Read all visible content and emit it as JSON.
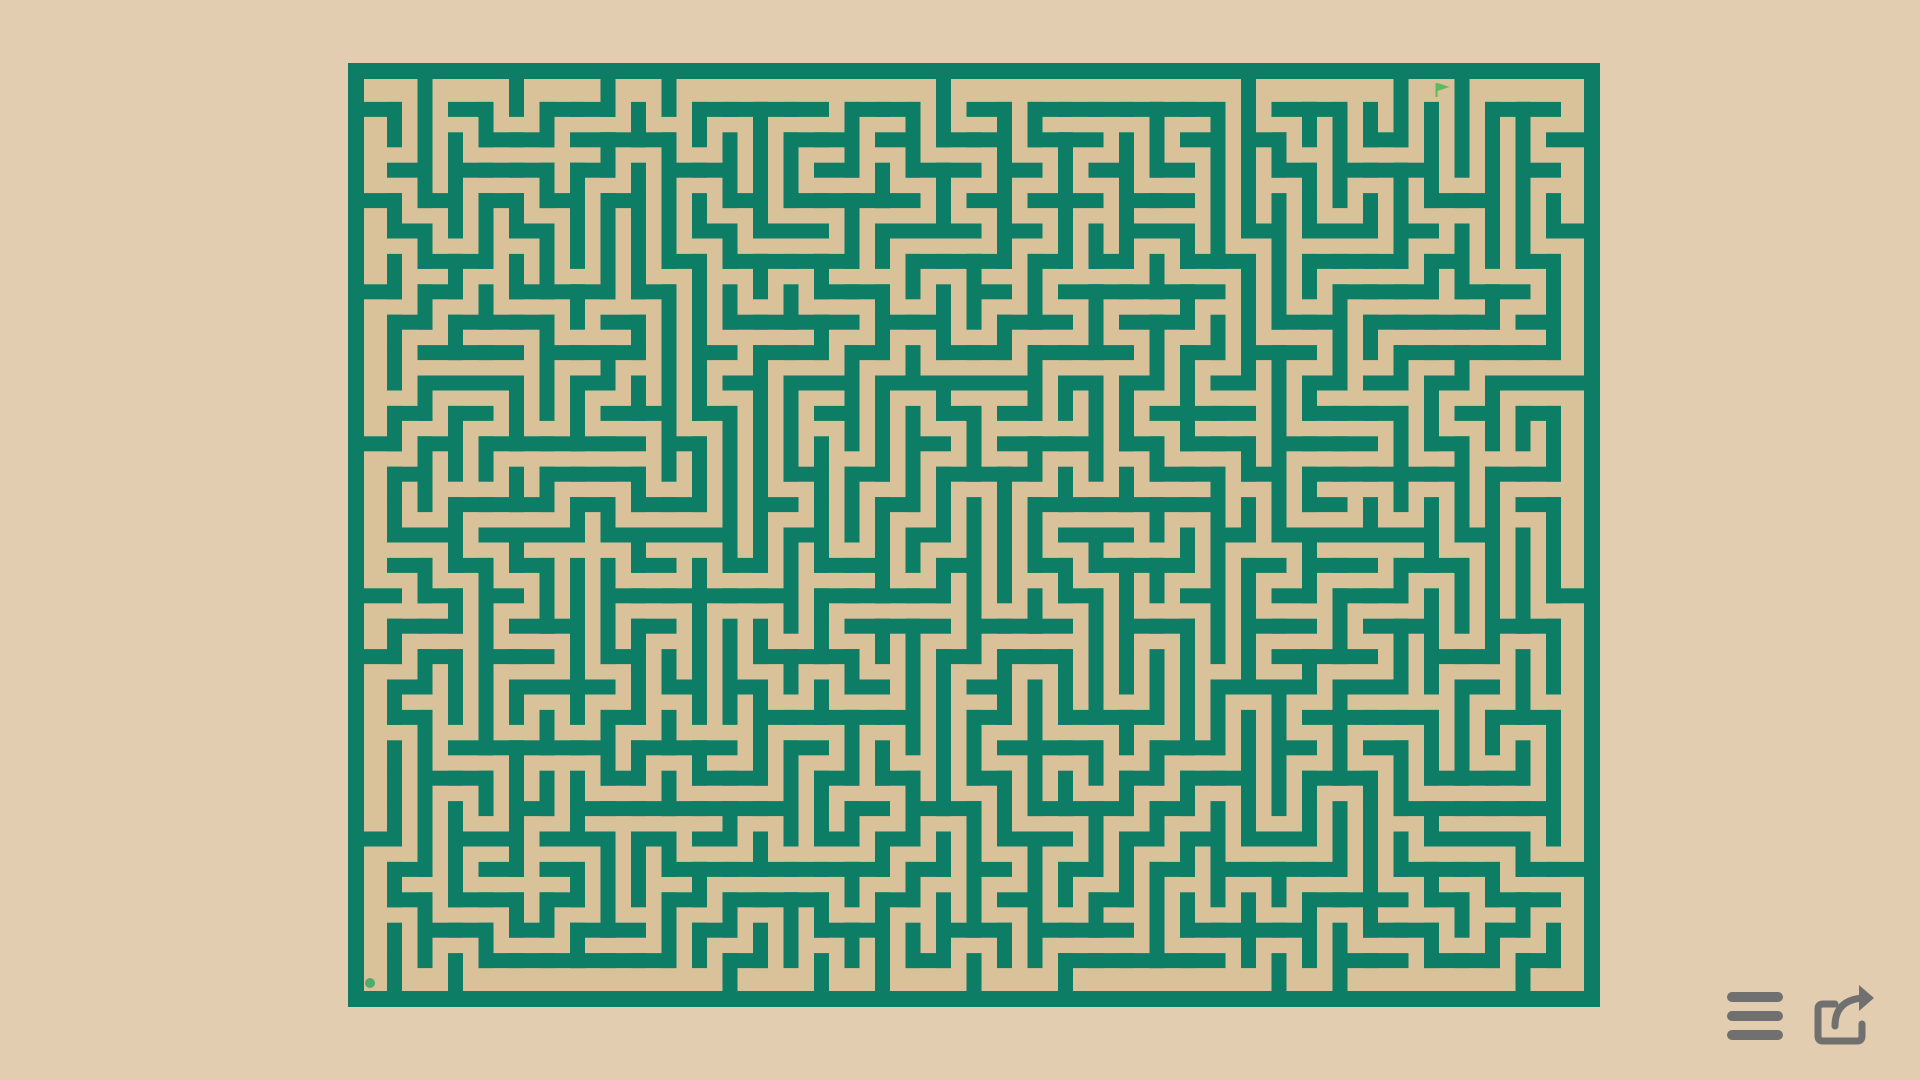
{
  "maze": {
    "cols": 40,
    "rows": 30,
    "seed": 20240611,
    "start": {
      "col": 0,
      "row": 29
    },
    "goal": {
      "col": 35,
      "row": 0
    }
  },
  "colors": {
    "background": "#e2cdb0",
    "path": "#d9c19a",
    "wall": "#0d7d66",
    "start_marker": "#4cae6a",
    "goal_marker": "#5dbb5d",
    "controls": "#707070"
  },
  "icons": {
    "menu": "hamburger-menu-icon",
    "share": "share-arrow-icon"
  }
}
